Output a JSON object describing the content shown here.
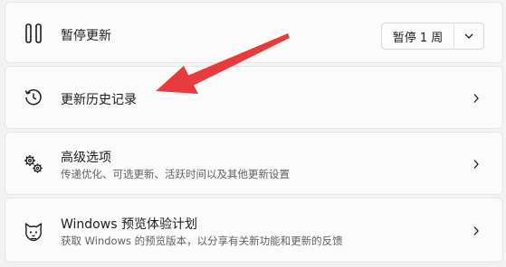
{
  "pause": {
    "label": "暂停更新",
    "button_label": "暂停 1 周",
    "icon": "pause-icon"
  },
  "history": {
    "label": "更新历史记录",
    "icon": "history-icon"
  },
  "advanced": {
    "label": "高级选项",
    "description": "传递优化、可选更新、活跃时间以及其他更新设置",
    "icon": "gears-icon"
  },
  "insider": {
    "label": "Windows 预览体验计划",
    "description": "获取 Windows 的预览版本，以分享有关新功能和更新的反馈",
    "icon": "cat-icon"
  },
  "colors": {
    "annotation_arrow": "#e83b3b"
  }
}
